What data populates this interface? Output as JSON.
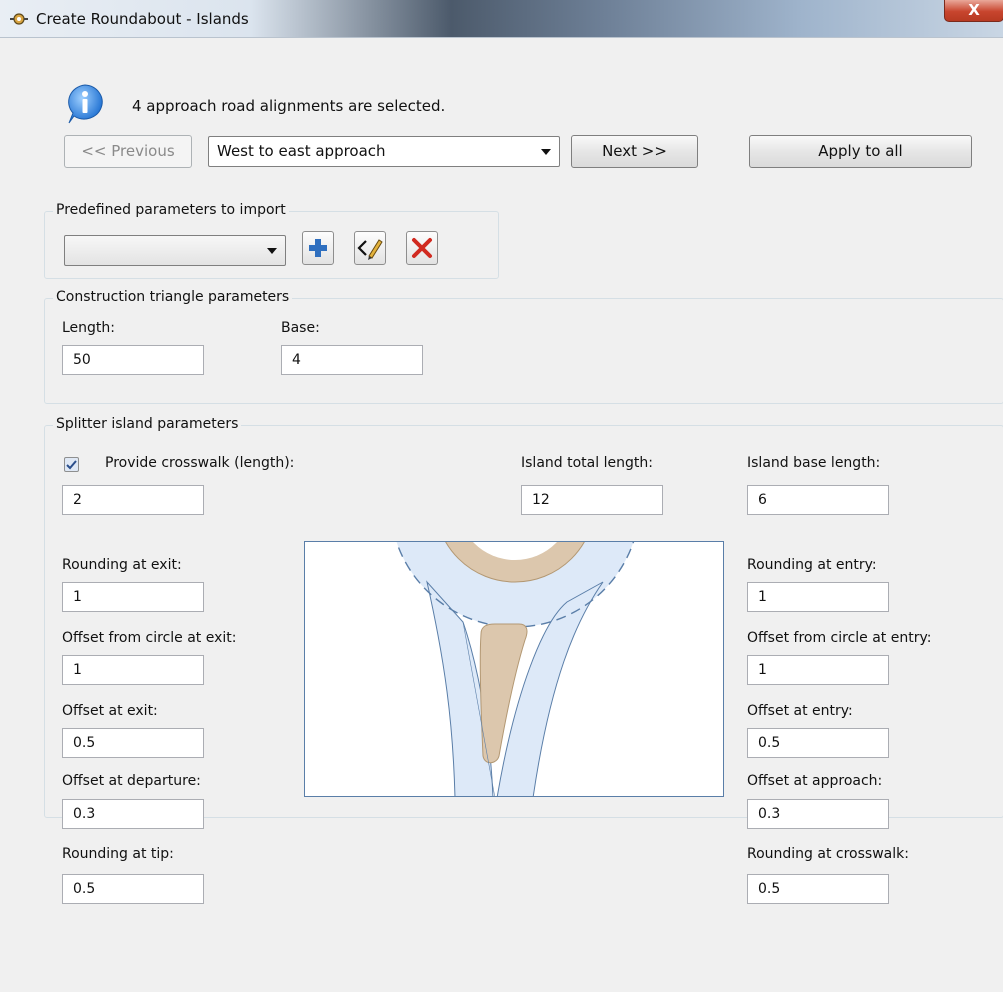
{
  "window": {
    "title": "Create Roundabout - Islands",
    "close_symbol": "X",
    "app_icon": "roundabout-icon"
  },
  "info": {
    "icon": "info-icon",
    "message": "4 approach road alignments are selected."
  },
  "navigation": {
    "previous_label": "<< Previous",
    "approach_selected": "West to east approach",
    "next_label": "Next >>",
    "apply_all_label": "Apply to all"
  },
  "predefined": {
    "group_label": "Predefined parameters to import",
    "selected": "",
    "add_icon": "add-icon",
    "edit_icon": "edit-icon",
    "delete_icon": "delete-icon"
  },
  "construction": {
    "group_label": "Construction triangle parameters",
    "length_label": "Length:",
    "length_value": "50",
    "base_label": "Base:",
    "base_value": "4"
  },
  "splitter": {
    "group_label": "Splitter island parameters",
    "crosswalk_label": "Provide crosswalk (length):",
    "crosswalk_checked": true,
    "crosswalk_value": "2",
    "total_length_label": "Island total length:",
    "total_length_value": "12",
    "base_length_label": "Island base length:",
    "base_length_value": "6",
    "left": [
      {
        "label": "Rounding at exit:",
        "value": "1"
      },
      {
        "label": "Offset from circle at exit:",
        "value": "1"
      },
      {
        "label": "Offset at exit:",
        "value": "0.5"
      },
      {
        "label": "Offset at departure:",
        "value": "0.3"
      },
      {
        "label": "Rounding at tip:",
        "value": "0.5"
      }
    ],
    "right": [
      {
        "label": "Rounding at entry:",
        "value": "1"
      },
      {
        "label": "Offset from circle at entry:",
        "value": "1"
      },
      {
        "label": "Offset at entry:",
        "value": "0.5"
      },
      {
        "label": "Offset at approach:",
        "value": "0.3"
      },
      {
        "label": "Rounding at crosswalk:",
        "value": "0.5"
      }
    ]
  },
  "colors": {
    "road_fill": "#dde9f8",
    "road_edge": "#5a7ea8",
    "island_fill": "#dcc7ad",
    "island_edge": "#b39873"
  }
}
